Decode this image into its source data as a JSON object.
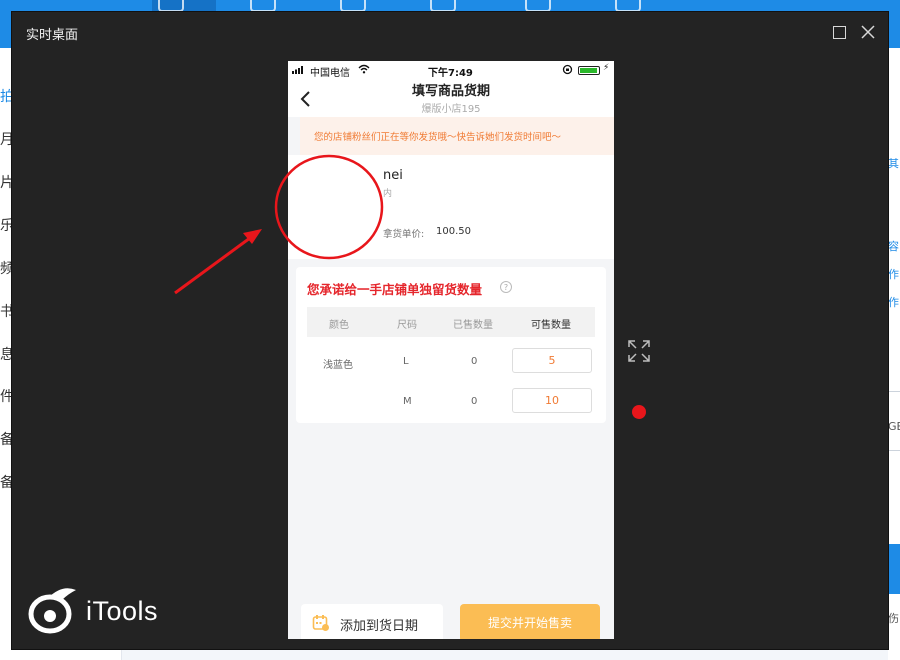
{
  "background": {
    "sidebar_fragments": [
      "拍",
      "月",
      "片",
      "乐",
      "频",
      "书",
      "息",
      "件",
      "备",
      "备"
    ],
    "right_fragments": [
      "其",
      "容",
      "作",
      "作",
      "GB",
      "伤"
    ]
  },
  "window": {
    "title": "实时桌面",
    "maximize_icon": "maximize-icon",
    "close_icon": "close-icon",
    "expand_icon": "expand-arrows-icon",
    "record_indicator_color": "#e8161b",
    "logo_text": "iTools"
  },
  "phone": {
    "status": {
      "carrier": "中国电信",
      "time": "下午7:49"
    },
    "nav": {
      "title": "填写商品货期",
      "subtitle": "爆版小店195"
    },
    "notice": "您的店铺粉丝们正在等你发货哦～快告诉她们发货时间吧～",
    "product": {
      "name": "nei",
      "category": "内",
      "price_label": "拿货单价:",
      "price": "100.50"
    },
    "stock": {
      "heading": "您承诺给一手店铺单独留货数量",
      "help_icon": "question-icon",
      "columns": [
        "颜色",
        "尺码",
        "已售数量",
        "可售数量"
      ],
      "rows": [
        {
          "color": "浅蓝色",
          "size": "L",
          "sold": "0",
          "available": "5"
        },
        {
          "color": "",
          "size": "M",
          "sold": "0",
          "available": "10"
        }
      ]
    },
    "footer": {
      "add_date_label": "添加到货日期",
      "submit_label": "提交并开始售卖"
    }
  },
  "colors": {
    "accent_orange": "#f07a33",
    "heading_red": "#e5262c",
    "submit_bg": "#fbbd54",
    "annotation_red": "#e8161b"
  }
}
